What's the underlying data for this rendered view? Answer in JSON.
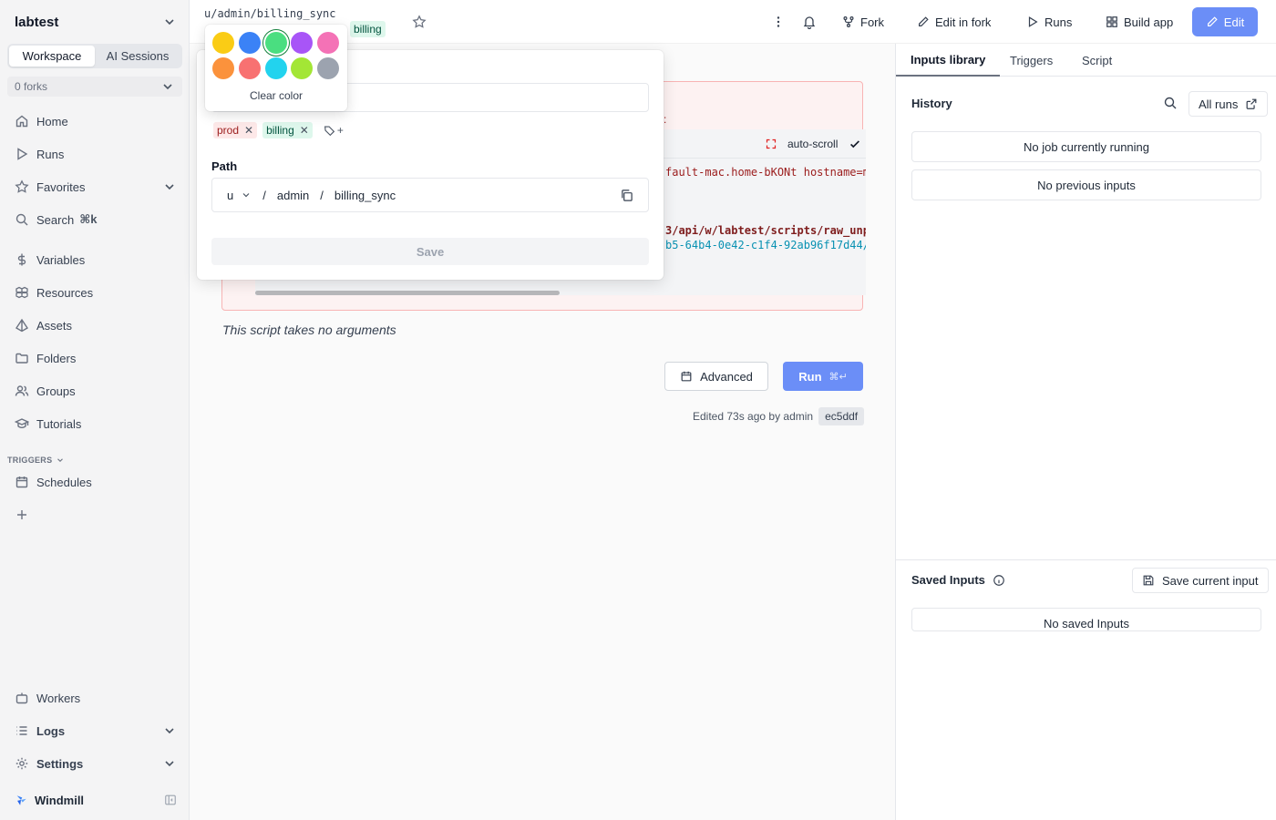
{
  "sidebar": {
    "workspace": "labtest",
    "tabs": [
      "Workspace",
      "AI Sessions"
    ],
    "forks": "0 forks",
    "nav": [
      {
        "label": "Home",
        "icon": "home-icon"
      },
      {
        "label": "Runs",
        "icon": "play-icon"
      },
      {
        "label": "Favorites",
        "icon": "star-icon"
      },
      {
        "label": "Search",
        "icon": "search-icon",
        "shortcut": "⌘k"
      },
      {
        "label": "Variables",
        "icon": "dollar-icon"
      },
      {
        "label": "Resources",
        "icon": "boxes-icon"
      },
      {
        "label": "Assets",
        "icon": "pyramid-icon"
      },
      {
        "label": "Folders",
        "icon": "folder-icon"
      },
      {
        "label": "Groups",
        "icon": "users-icon"
      },
      {
        "label": "Tutorials",
        "icon": "graduation-cap-icon"
      }
    ],
    "triggers_heading": "TRIGGERS",
    "schedules": "Schedules",
    "bottom": [
      "Workers",
      "Logs",
      "Settings"
    ],
    "brand": "Windmill"
  },
  "topbar": {
    "path": "u/admin/billing_sync",
    "tag_billing": "billing",
    "actions": [
      "Fork",
      "Edit in fork",
      "Runs",
      "Build app"
    ],
    "edit": "Edit"
  },
  "popover": {
    "tags": [
      "prod",
      "billing"
    ],
    "tag_add": "+",
    "path_label": "Path",
    "path_owner": "u",
    "path_user": "admin",
    "path_name": "billing_sync",
    "path_sep": "/",
    "save": "Save"
  },
  "color_picker": {
    "colors": [
      "#facc15",
      "#3b82f6",
      "#4ade80",
      "#a855f7",
      "#f472b6",
      "#fb923c",
      "#f87171",
      "#22d3ee",
      "#a3e635",
      "#9ca3af"
    ],
    "selected": 2,
    "clear": "Clear color"
  },
  "main": {
    "alert_tail": ":",
    "log_auto_scroll": "auto-scroll",
    "log_line1": "fault-mac.home-bKONt hostname=m",
    "log_line2": "3/api/w/labtest/scripts/raw_unp",
    "log_line3": "b5-64b4-0e42-c1f4-92ab96f17d44/",
    "no_args": "This script takes no arguments",
    "advanced": "Advanced",
    "run": "Run",
    "run_kbd": "⌘↵",
    "edited": "Edited 73s ago by admin",
    "hash": "ec5ddf"
  },
  "right_panel": {
    "tabs": [
      "Inputs library",
      "Triggers",
      "Script"
    ],
    "history_title": "History",
    "all_runs": "All runs",
    "no_job": "No job currently running",
    "no_prev": "No previous inputs",
    "saved_title": "Saved Inputs",
    "save_current": "Save current input",
    "no_saved": "No saved Inputs"
  }
}
